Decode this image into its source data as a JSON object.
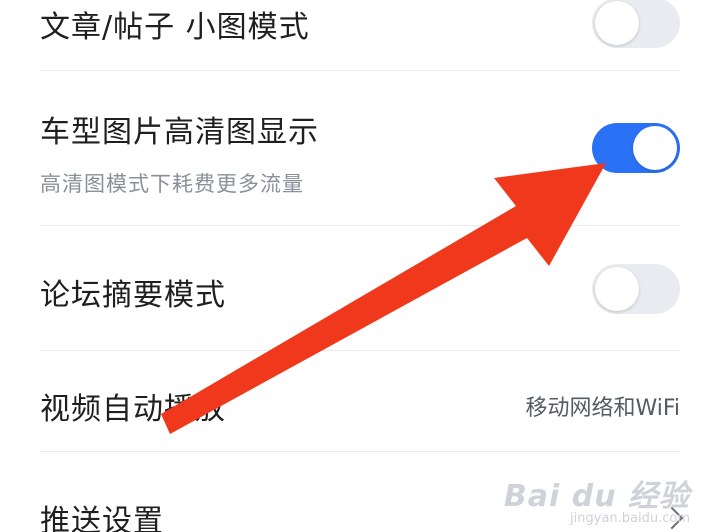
{
  "settings": {
    "row1": {
      "label": "文章/帖子 小图模式",
      "toggle_on": false
    },
    "row2": {
      "label": "车型图片高清图显示",
      "subtitle": "高清图模式下耗费更多流量",
      "toggle_on": true
    },
    "row3": {
      "label": "论坛摘要模式",
      "toggle_on": false
    },
    "row4": {
      "label": "视频自动播放",
      "value": "移动网络和WiFi"
    },
    "row5": {
      "label": "推送设置"
    }
  },
  "colors": {
    "toggle_on": "#2a72f5",
    "toggle_off": "#e9ebf0",
    "annotation_arrow": "#f0391c"
  },
  "watermark": {
    "brand": "Bai du 经验",
    "url": "jingyan.baidu.com"
  }
}
